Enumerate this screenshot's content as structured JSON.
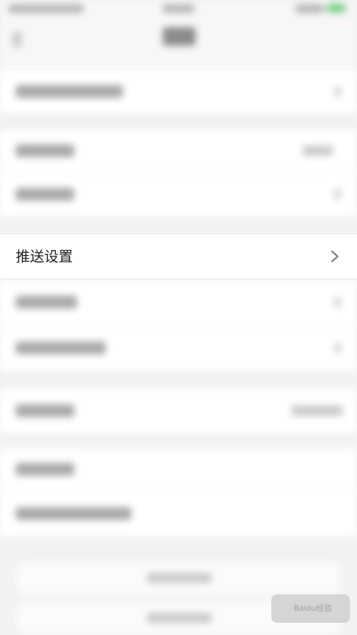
{
  "settings": {
    "push_settings_label": "推送设置"
  },
  "watermark": {
    "text": "Baidu经验"
  },
  "icons": {
    "chevron": "chevron-right-icon"
  }
}
